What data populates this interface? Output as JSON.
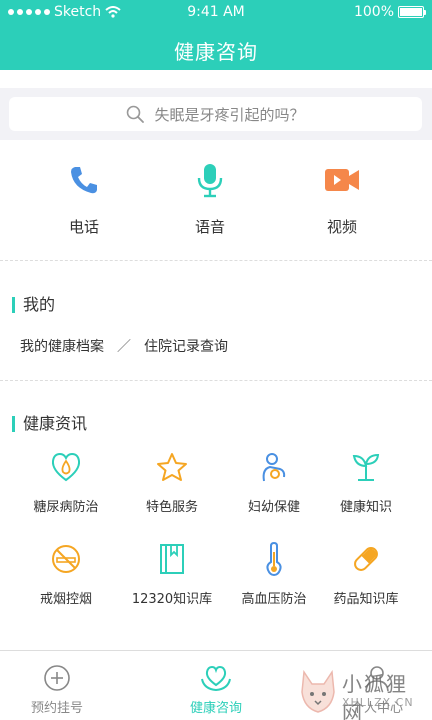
{
  "status": {
    "carrier": "Sketch",
    "time": "9:41 AM",
    "battery": "100%"
  },
  "header": {
    "title": "健康咨询"
  },
  "search": {
    "placeholder": "失眠是牙疼引起的吗？"
  },
  "quick_actions": [
    {
      "label": "电话",
      "icon": "phone-icon",
      "color": "#4a90e2"
    },
    {
      "label": "语音",
      "icon": "microphone-icon",
      "color": "#2ccfb9"
    },
    {
      "label": "视频",
      "icon": "video-camera-icon",
      "color": "#f5874a"
    }
  ],
  "mine": {
    "title": "我的",
    "records_link": "我的健康档案",
    "separator": "／",
    "hospital_link": "住院记录查询"
  },
  "news": {
    "title": "健康资讯",
    "items": [
      {
        "label": "糖尿病防治",
        "icon": "drop-heart-icon"
      },
      {
        "label": "特色服务",
        "icon": "star-icon"
      },
      {
        "label": "妇幼保健",
        "icon": "mother-baby-icon"
      },
      {
        "label": "健康知识",
        "icon": "sprout-icon"
      },
      {
        "label": "戒烟控烟",
        "icon": "no-smoking-icon"
      },
      {
        "label": "12320知识库",
        "icon": "book-icon"
      },
      {
        "label": "高血压防治",
        "icon": "thermometer-icon"
      },
      {
        "label": "药品知识库",
        "icon": "pill-icon"
      }
    ]
  },
  "tabbar": [
    {
      "label": "预约挂号",
      "icon": "plus-circle-icon",
      "active": false
    },
    {
      "label": "健康咨询",
      "icon": "heart-hands-icon",
      "active": true
    },
    {
      "label": "个人中心",
      "icon": "person-icon",
      "active": false
    }
  ],
  "watermark": {
    "brand": "小狐狸网",
    "site": "XHLLZX.CN"
  },
  "colors": {
    "accent": "#2ccfb9",
    "orange": "#f5a623",
    "blue": "#4a90e2",
    "inactive": "#888888"
  }
}
